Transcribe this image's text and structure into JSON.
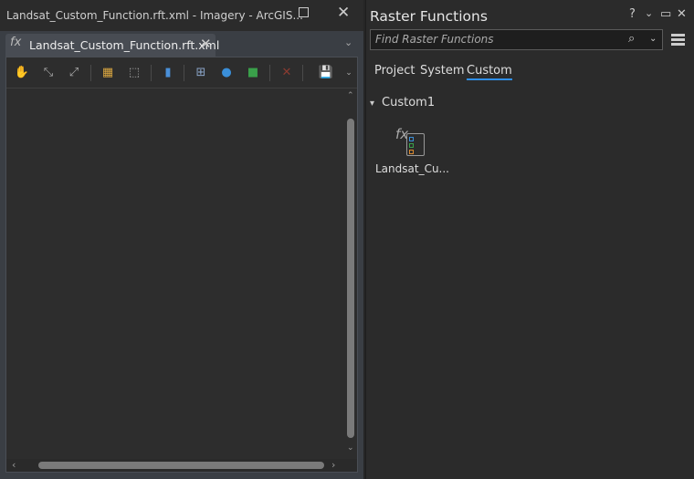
{
  "left_window": {
    "title": "Landsat_Custom_Function.rft.xml - Imagery - ArcGIS...",
    "tab_label": "Landsat_Custom_Function.rft.xml",
    "toolbar": [
      "pan-icon",
      "collapse-icon",
      "expand-icon",
      "layout-icon",
      "fit-icon",
      "add-raster-variable-icon",
      "add-function-icon",
      "add-raster-icon",
      "add-new-icon",
      "delete-icon",
      "save-function-icon"
    ]
  },
  "raster_functions": {
    "title": "Raster Functions",
    "search_placeholder": "Find Raster Functions",
    "tabs": [
      {
        "label": "Project"
      },
      {
        "label": "System"
      },
      {
        "label": "Custom",
        "active": true
      }
    ],
    "group": {
      "label": "Custom1",
      "items": [
        {
          "label": "Landsat_Cu..."
        }
      ]
    }
  },
  "colors": {
    "accent": "#2f8fe8"
  }
}
